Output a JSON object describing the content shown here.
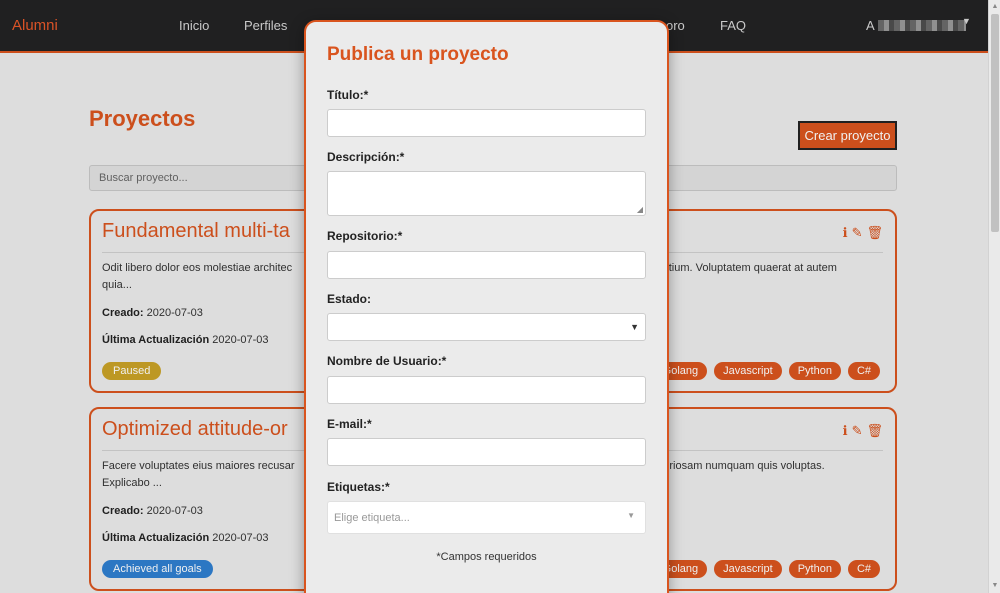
{
  "navbar": {
    "brand": "Alumni",
    "links": [
      "Inicio",
      "Perfiles",
      "oro",
      "FAQ"
    ],
    "user_initial": "A"
  },
  "page": {
    "title": "Proyectos",
    "create_button": "Crear proyecto",
    "search_placeholder": "Buscar proyecto..."
  },
  "cards": [
    {
      "title": "Fundamental multi-ta",
      "desc_left": "Odit libero dolor eos molestiae architec quia...",
      "desc_right": "santium. Voluptatem quaerat at autem",
      "created_label": "Creado:",
      "created": "2020-07-03",
      "updated_label": "Última Actualización",
      "updated": "2020-07-03",
      "status": "Paused",
      "status_color": "#c9a227",
      "tags": [
        "Golang",
        "Javascript",
        "Python",
        "C#"
      ]
    },
    {
      "title": "Optimized attitude-or",
      "desc_left": "Facere voluptates eius maiores recusar Explicabo ...",
      "desc_right": "aboriosam numquam quis voluptas.",
      "created_label": "Creado:",
      "created": "2020-07-03",
      "updated_label": "Última Actualización",
      "updated": "2020-07-03",
      "status": "Achieved all goals",
      "status_color": "#2f7fd0",
      "tags": [
        "Golang",
        "Javascript",
        "Python",
        "C#"
      ]
    }
  ],
  "modal": {
    "title": "Publica un proyecto",
    "fields": {
      "titulo": "Título:*",
      "descripcion": "Descripción:*",
      "repositorio": "Repositorio:*",
      "estado": "Estado:",
      "usuario": "Nombre de Usuario:*",
      "email": "E-mail:*",
      "etiquetas": "Etiquetas:*"
    },
    "tags_placeholder": "Elige etiqueta...",
    "required_note": "*Campos requeridos"
  },
  "colors": {
    "accent": "#d9541e",
    "navbar": "#222224"
  }
}
